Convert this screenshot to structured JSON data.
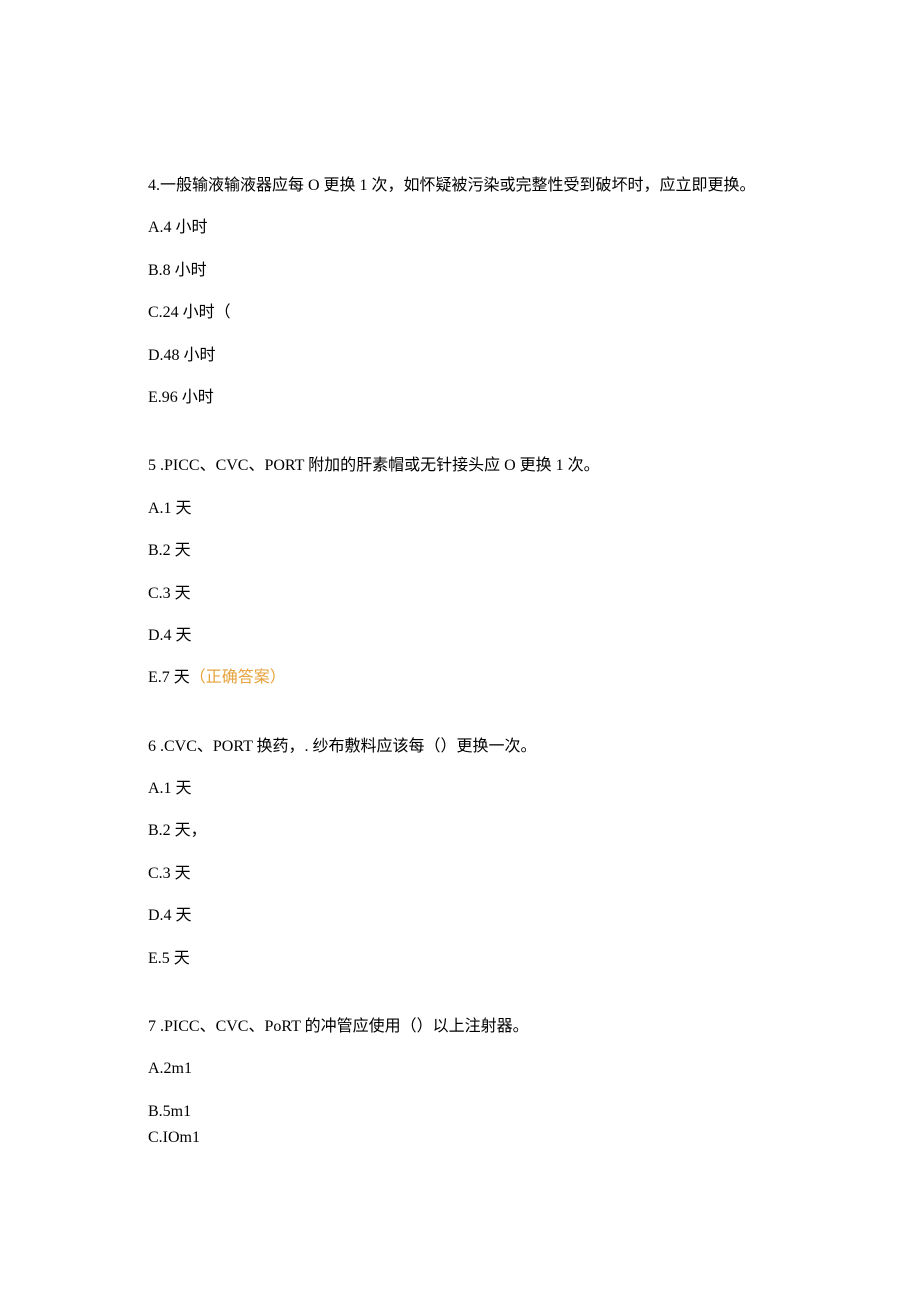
{
  "questions": [
    {
      "stem": "4.一般输液输液器应每 O 更换 1 次，如怀疑被污染或完整性受到破坏时，应立即更换。",
      "options": [
        {
          "text": "A.4 小时",
          "correct": false
        },
        {
          "text": "B.8 小时",
          "correct": false
        },
        {
          "text": "C.24 小时（",
          "correct": false
        },
        {
          "text": "D.48 小时",
          "correct": false
        },
        {
          "text": "E.96 小时",
          "correct": false
        }
      ]
    },
    {
      "stem": "5  .PICC、CVC、PORT 附加的肝素帽或无针接头应 O 更换 1 次。",
      "options": [
        {
          "text": "A.1 天",
          "correct": false
        },
        {
          "text": "B.2 天",
          "correct": false
        },
        {
          "text": "C.3 天",
          "correct": false
        },
        {
          "text": "D.4 天",
          "correct": false
        },
        {
          "text": "E.7 天",
          "correct": true
        }
      ]
    },
    {
      "stem": "6  .CVC、PORT 换药，. 纱布敷料应该每（）更换一次。",
      "options": [
        {
          "text": "A.1 天",
          "correct": false
        },
        {
          "text": "B.2 天，",
          "correct": false
        },
        {
          "text": "C.3 天",
          "correct": false
        },
        {
          "text": "D.4 天",
          "correct": false
        },
        {
          "text": "E.5 天",
          "correct": false
        }
      ]
    },
    {
      "stem": "7  .PICC、CVC、PoRT 的冲管应使用（）以上注射器。",
      "options": [
        {
          "text": "A.2m1",
          "correct": false
        },
        {
          "text": "B.5m1",
          "correct": false,
          "tight": true
        },
        {
          "text": "C.IOm1",
          "correct": false
        }
      ]
    }
  ],
  "answer_marker": "（正确答案）"
}
